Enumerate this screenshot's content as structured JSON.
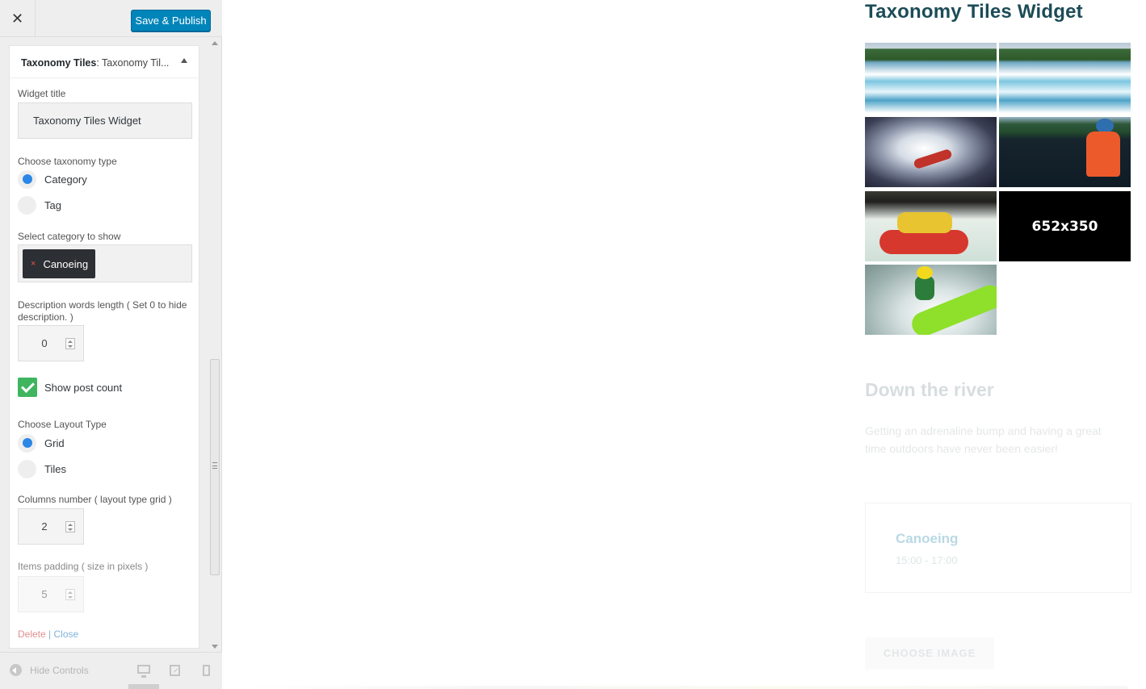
{
  "topbar": {
    "close_glyph": "✕",
    "publish_label": "Save & Publish"
  },
  "widget": {
    "header_title": "Taxonomy Tiles",
    "header_subtitle": ": Taxonomy Til...",
    "title_label": "Widget title",
    "title_value": "Taxonomy Tiles Widget",
    "taxonomy_label": "Choose taxonomy type",
    "taxonomy_options": [
      {
        "label": "Category",
        "selected": true
      },
      {
        "label": "Tag",
        "selected": false
      }
    ],
    "category_label": "Select category to show",
    "category_chip": "Canoeing",
    "category_chip_remove": "×",
    "desc_label": "Description words length ( Set 0 to hide description. )",
    "desc_value": "0",
    "post_count_label": "Show post count",
    "post_count_checked": true,
    "layout_label": "Choose Layout Type",
    "layout_options": [
      {
        "label": "Grid",
        "selected": true
      },
      {
        "label": "Tiles",
        "selected": false
      }
    ],
    "columns_label": "Columns number ( layout type grid )",
    "columns_value": "2",
    "padding_label": "Items padding ( size in pixels )",
    "padding_value": "5",
    "delete_label": "Delete",
    "separator": "|",
    "close_label": "Close"
  },
  "footer": {
    "hide_controls_label": "Hide Controls",
    "devices": [
      "desktop-icon",
      "tablet-icon",
      "mobile-icon"
    ]
  },
  "preview": {
    "title": "Taxonomy Tiles Widget",
    "placeholder_label": "652x350",
    "section_heading": "Down the river",
    "section_text": "Getting an adrenaline bump and having a great time outdoors have never been easier!",
    "event_title": "Canoeing",
    "event_time": "15:00 - 17:00",
    "choose_image_label": "CHOOSE IMAGE"
  },
  "colors": {
    "publish_blue": "#0085ba",
    "radio_blue": "#2a87e6",
    "check_green": "#3fb55f",
    "title_teal": "#1c4c57",
    "delete_red": "#e08f8f"
  }
}
